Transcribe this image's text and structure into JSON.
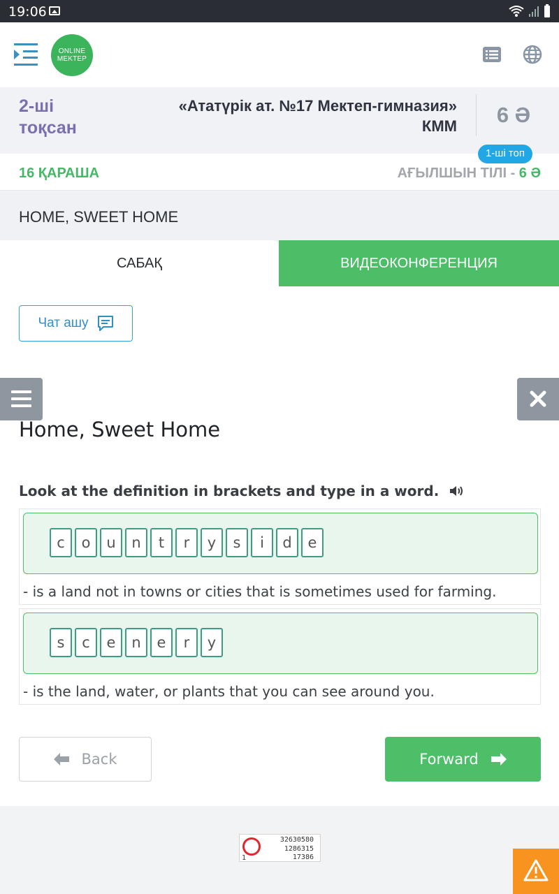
{
  "status_bar": {
    "time": "19:06"
  },
  "header": {
    "logo_line1": "ONLINE",
    "logo_line2": "MEKTEP"
  },
  "info": {
    "quarter_line1": "2-ші",
    "quarter_line2": "тоқсан",
    "school_line1": "«Ататүрік ат. №17 Мектеп-гимназия»",
    "school_line2": "КММ",
    "grade": "6 Ә",
    "group_badge": "1-ші топ"
  },
  "date_bar": {
    "date": "16 ҚАРАША",
    "subject": "АҒЫЛШЫН ТІЛІ - ",
    "subject_grade": "6 Ә"
  },
  "lesson": {
    "title": "HOME, SWEET HOME"
  },
  "tabs": [
    {
      "label": "САБАҚ",
      "active": true
    },
    {
      "label": "ВИДЕОКОНФЕРЕНЦИЯ",
      "active": false
    }
  ],
  "chat_button": {
    "label": "Чат ашу"
  },
  "task": {
    "title": "Home, Sweet Home",
    "instruction": "Look at the definition in brackets and type in a word.",
    "items": [
      {
        "letters": [
          "c",
          "o",
          "u",
          "n",
          "t",
          "r",
          "y",
          "s",
          "i",
          "d",
          "e"
        ],
        "definition": "- is a land not in towns or cities that is sometimes used for farming."
      },
      {
        "letters": [
          "s",
          "c",
          "e",
          "n",
          "e",
          "r",
          "y"
        ],
        "definition": "- is the land, water, or plants that you can see around you."
      }
    ]
  },
  "navigation": {
    "back_label": "Back",
    "forward_label": "Forward"
  },
  "counter": {
    "corner": "1",
    "line1": "32630580",
    "line2": "1286315",
    "line3": "17386"
  },
  "colors": {
    "brand_green": "#4cbf68",
    "quarter_purple": "#7c6fb0",
    "badge_blue": "#22a7e6",
    "warning_orange": "#f7931e"
  },
  "icons": [
    "menu-indent-icon",
    "list-icon",
    "globe-icon",
    "chat-icon",
    "hamburger-icon",
    "close-icon",
    "speaker-icon",
    "arrow-left-icon",
    "arrow-right-icon",
    "warning-icon"
  ]
}
